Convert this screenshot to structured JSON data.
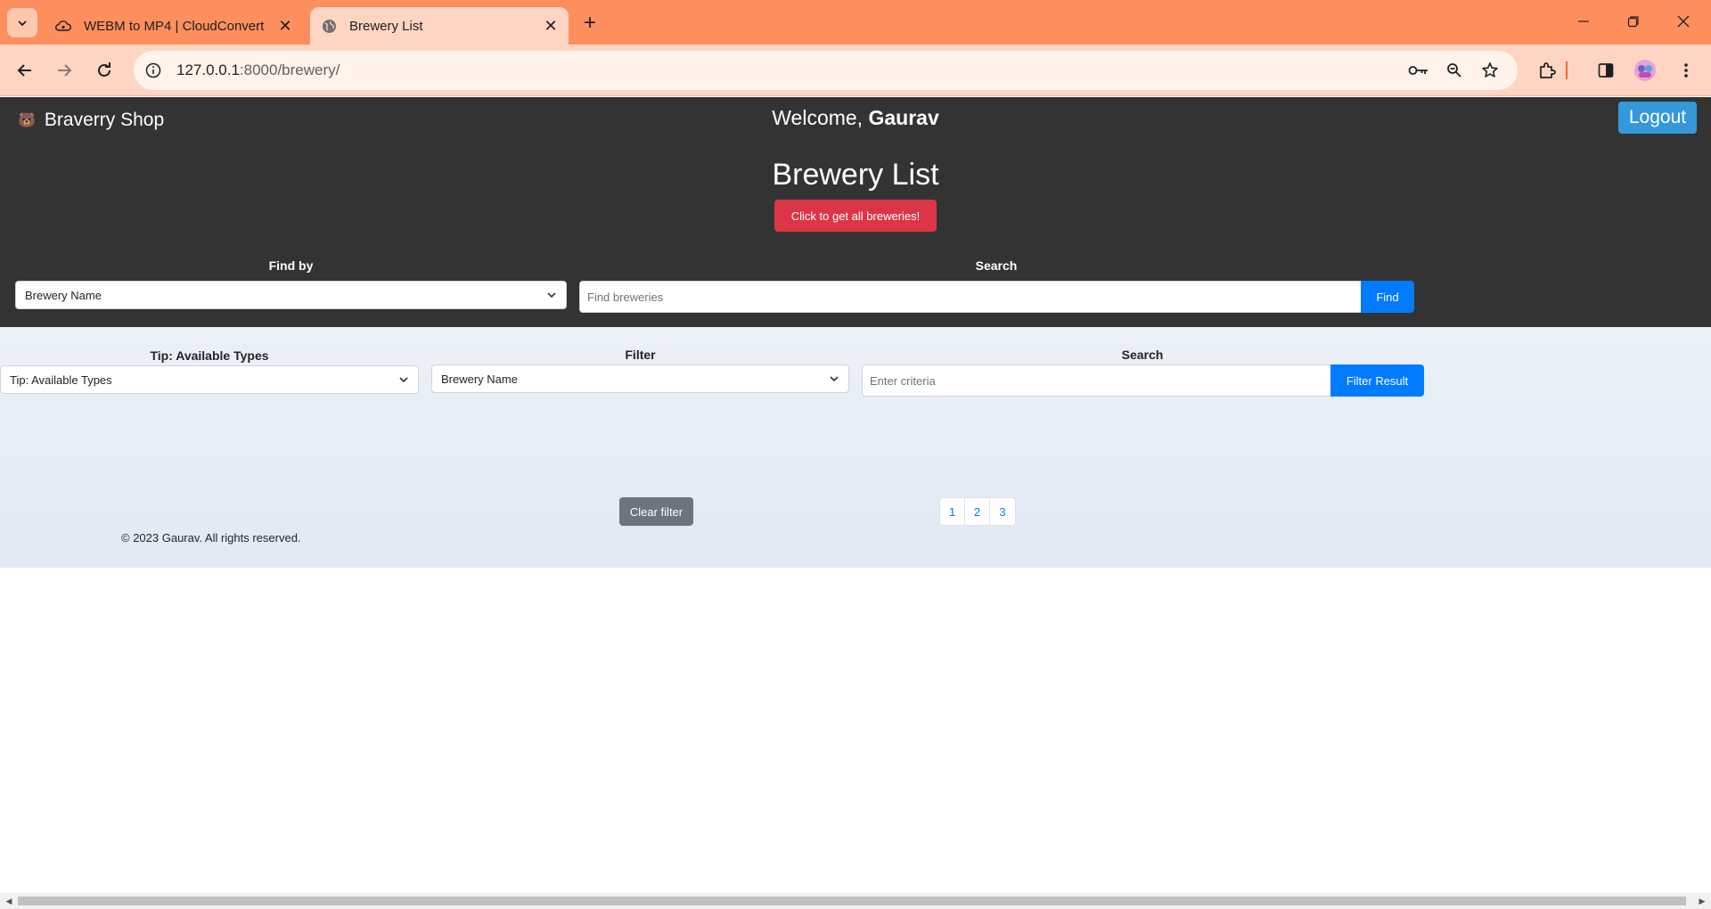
{
  "browser": {
    "tabs": [
      {
        "title": "WEBM to MP4 | CloudConvert",
        "active": false
      },
      {
        "title": "Brewery List",
        "active": true
      }
    ],
    "url_host": "127.0.0.1",
    "url_path": ":8000/brewery/",
    "accent": "#fd8f5f"
  },
  "header": {
    "brand": "Braverry Shop",
    "welcome_prefix": "Welcome, ",
    "username": "Gaurav",
    "logout_label": "Logout",
    "page_title": "Brewery List",
    "get_all_label": "Click to get all breweries!"
  },
  "find": {
    "find_by_label": "Find by",
    "find_by_value": "Brewery Name",
    "search_label": "Search",
    "search_placeholder": "Find breweries",
    "find_button": "Find"
  },
  "filters": {
    "tip_label": "Tip: Available Types",
    "tip_value": "Tip: Available Types",
    "filter_label": "Filter",
    "filter_value": "Brewery Name",
    "search_label": "Search",
    "search_placeholder": "Enter criteria",
    "filter_button": "Filter Result",
    "clear_button": "Clear filter",
    "pages": [
      "1",
      "2",
      "3"
    ]
  },
  "footer": {
    "copyright": "© 2023 Gaurav. All rights reserved."
  },
  "colors": {
    "header_bg": "#333333",
    "logout": "#3498db",
    "danger": "#dc3545",
    "primary": "#007bff",
    "secondary": "#6c757d"
  }
}
